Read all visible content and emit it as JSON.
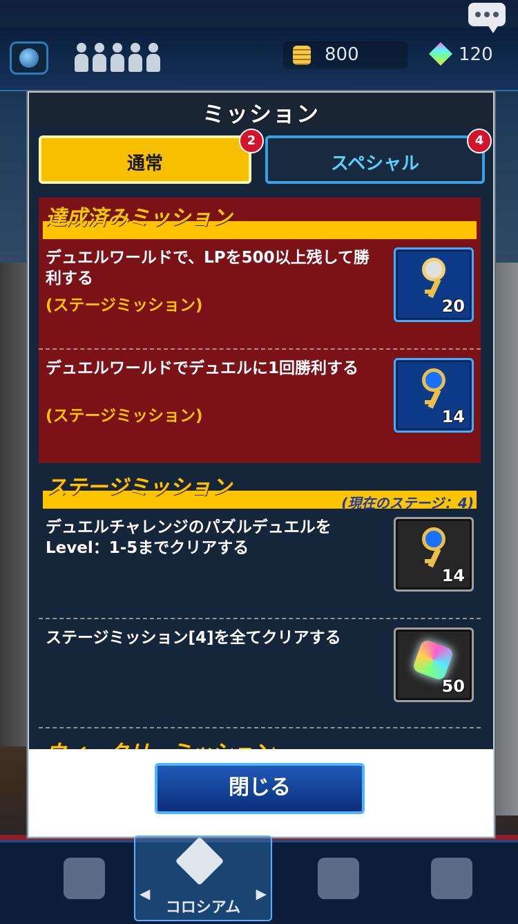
{
  "topbar": {
    "coins": "800",
    "gems": "120"
  },
  "dialog": {
    "title": "ミッション",
    "tabs": [
      {
        "label": "通常",
        "badge": "2"
      },
      {
        "label": "スペシャル",
        "badge": "4"
      }
    ],
    "sections": {
      "completed": {
        "title": "達成済みミッション",
        "missions": [
          {
            "text": "デュエルワールドで、LPを500以上残して勝利する",
            "sub": "(ステージミッション)",
            "reward_icon": "silver-key-icon",
            "reward_count": "20"
          },
          {
            "text": "デュエルワールドでデュエルに1回勝利する",
            "sub": "(ステージミッション)",
            "reward_icon": "blue-key-icon",
            "reward_count": "14"
          }
        ]
      },
      "stage": {
        "title": "ステージミッション",
        "note": "(現在のステージ：4)",
        "missions": [
          {
            "text": "デュエルチャレンジのパズルデュエルをLevel：1-5までクリアする",
            "reward_icon": "blue-key-icon",
            "reward_count": "14"
          },
          {
            "text": "ステージミッション[4]を全てクリアする",
            "reward_icon": "gem-icon",
            "reward_count": "50"
          }
        ]
      },
      "weekly": {
        "title": "ウィークリーミッション"
      }
    },
    "close_label": "閉じる"
  },
  "bottom_nav": {
    "colosseum_label": "コロシアム"
  },
  "colors": {
    "accent_yellow": "#ffc400",
    "completed_bg": "#7a1217",
    "panel_bg": "#16263a",
    "button_blue": "#1f5ab8"
  }
}
